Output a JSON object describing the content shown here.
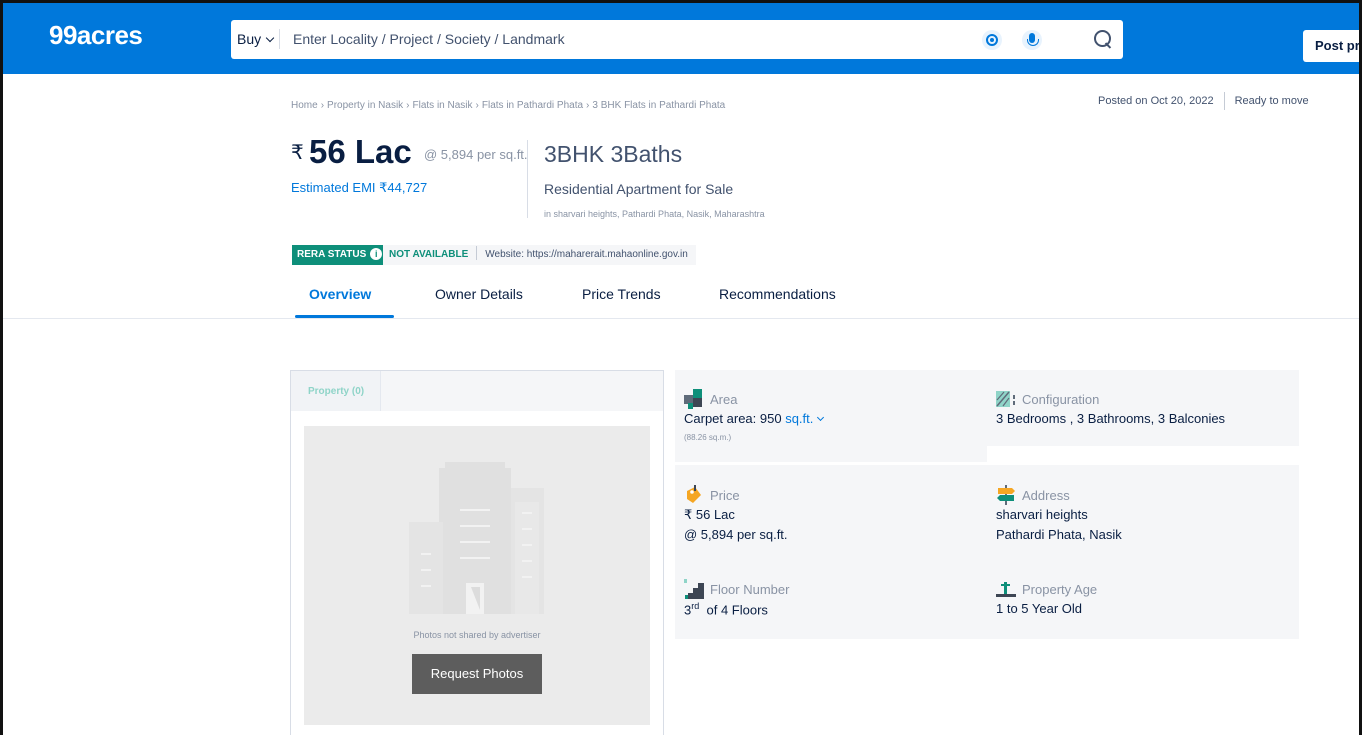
{
  "header": {
    "logo": "99acres",
    "buy_label": "Buy",
    "search_placeholder": "Enter Locality / Project / Society / Landmark",
    "post_label": "Post pr"
  },
  "breadcrumb": [
    "Home",
    "Property in Nasik",
    "Flats in Nasik",
    "Flats in Pathardi Phata",
    "3 BHK Flats in Pathardi Phata"
  ],
  "posted": {
    "date": "Posted on Oct 20, 2022",
    "status": "Ready to move"
  },
  "price": {
    "currency": "₹",
    "amount": "56 Lac",
    "rate": "@ 5,894 per sq.ft.",
    "emi": "Estimated EMI ₹44,727"
  },
  "config": {
    "title": "3BHK 3Baths",
    "subtitle": "Residential Apartment for Sale",
    "location": "in sharvari heights, Pathardi Phata, Nasik, Maharashtra"
  },
  "rera": {
    "badge": "RERA STATUS",
    "info": "i",
    "status": "NOT AVAILABLE",
    "website": "Website: https://maharerait.mahaonline.gov.in"
  },
  "tabs": [
    "Overview",
    "Owner Details",
    "Price Trends",
    "Recommendations"
  ],
  "photos": {
    "tab_label": "Property (0)",
    "empty_text": "Photos not shared by advertiser",
    "request_label": "Request Photos"
  },
  "details": {
    "area": {
      "label": "Area",
      "value_prefix": "Carpet area: 950",
      "unit": "sq.ft.",
      "sub": "(88.26 sq.m.)"
    },
    "configuration": {
      "label": "Configuration",
      "value": "3 Bedrooms , 3 Bathrooms, 3 Balconies"
    },
    "price": {
      "label": "Price",
      "value": "₹ 56 Lac",
      "rate": "@ 5,894 per sq.ft."
    },
    "address": {
      "label": "Address",
      "line1": "sharvari heights",
      "line2": "Pathardi Phata, Nasik"
    },
    "floor": {
      "label": "Floor Number",
      "floor_num": "3",
      "floor_sup": "rd",
      "floor_rest": "of 4 Floors"
    },
    "age": {
      "label": "Property Age",
      "value": "1 to 5 Year Old"
    }
  },
  "colors": {
    "brand": "#0078db",
    "rera_green": "#0e8f7a",
    "card_bg": "#f5f6f8"
  },
  "icons": [
    "location-target-icon",
    "mic-icon",
    "search-icon",
    "info-icon",
    "building-placeholder-icon",
    "area-icon",
    "configuration-icon",
    "price-tag-icon",
    "address-signpost-icon",
    "floor-stairs-icon",
    "property-age-icon"
  ]
}
